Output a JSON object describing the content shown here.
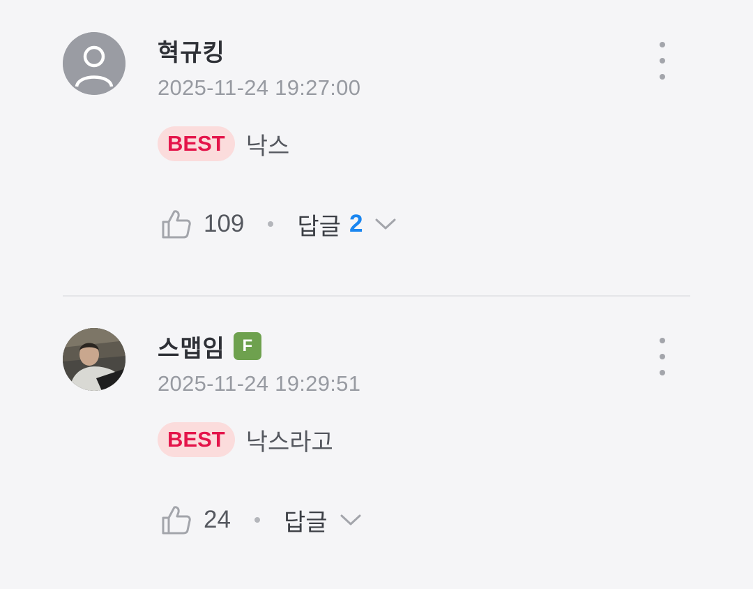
{
  "comments": [
    {
      "username": "혁규킹",
      "timestamp": "2025-11-24 19:27:00",
      "best_label": "BEST",
      "text": "낙스",
      "likes": "109",
      "reply_label": "답글",
      "reply_count": "2",
      "avatar": "default-user-icon",
      "badge": ""
    },
    {
      "username": "스맵임",
      "timestamp": "2025-11-24 19:29:51",
      "best_label": "BEST",
      "text": "낙스라고",
      "likes": "24",
      "reply_label": "답글",
      "reply_count": "",
      "avatar": "profile-photo",
      "badge": "F"
    }
  ],
  "colors": {
    "background": "#f5f5f7",
    "best_bg": "#fbdcdc",
    "best_text": "#e4144a",
    "reply_count": "#1a86f0",
    "fan_badge": "#6ea14e"
  }
}
